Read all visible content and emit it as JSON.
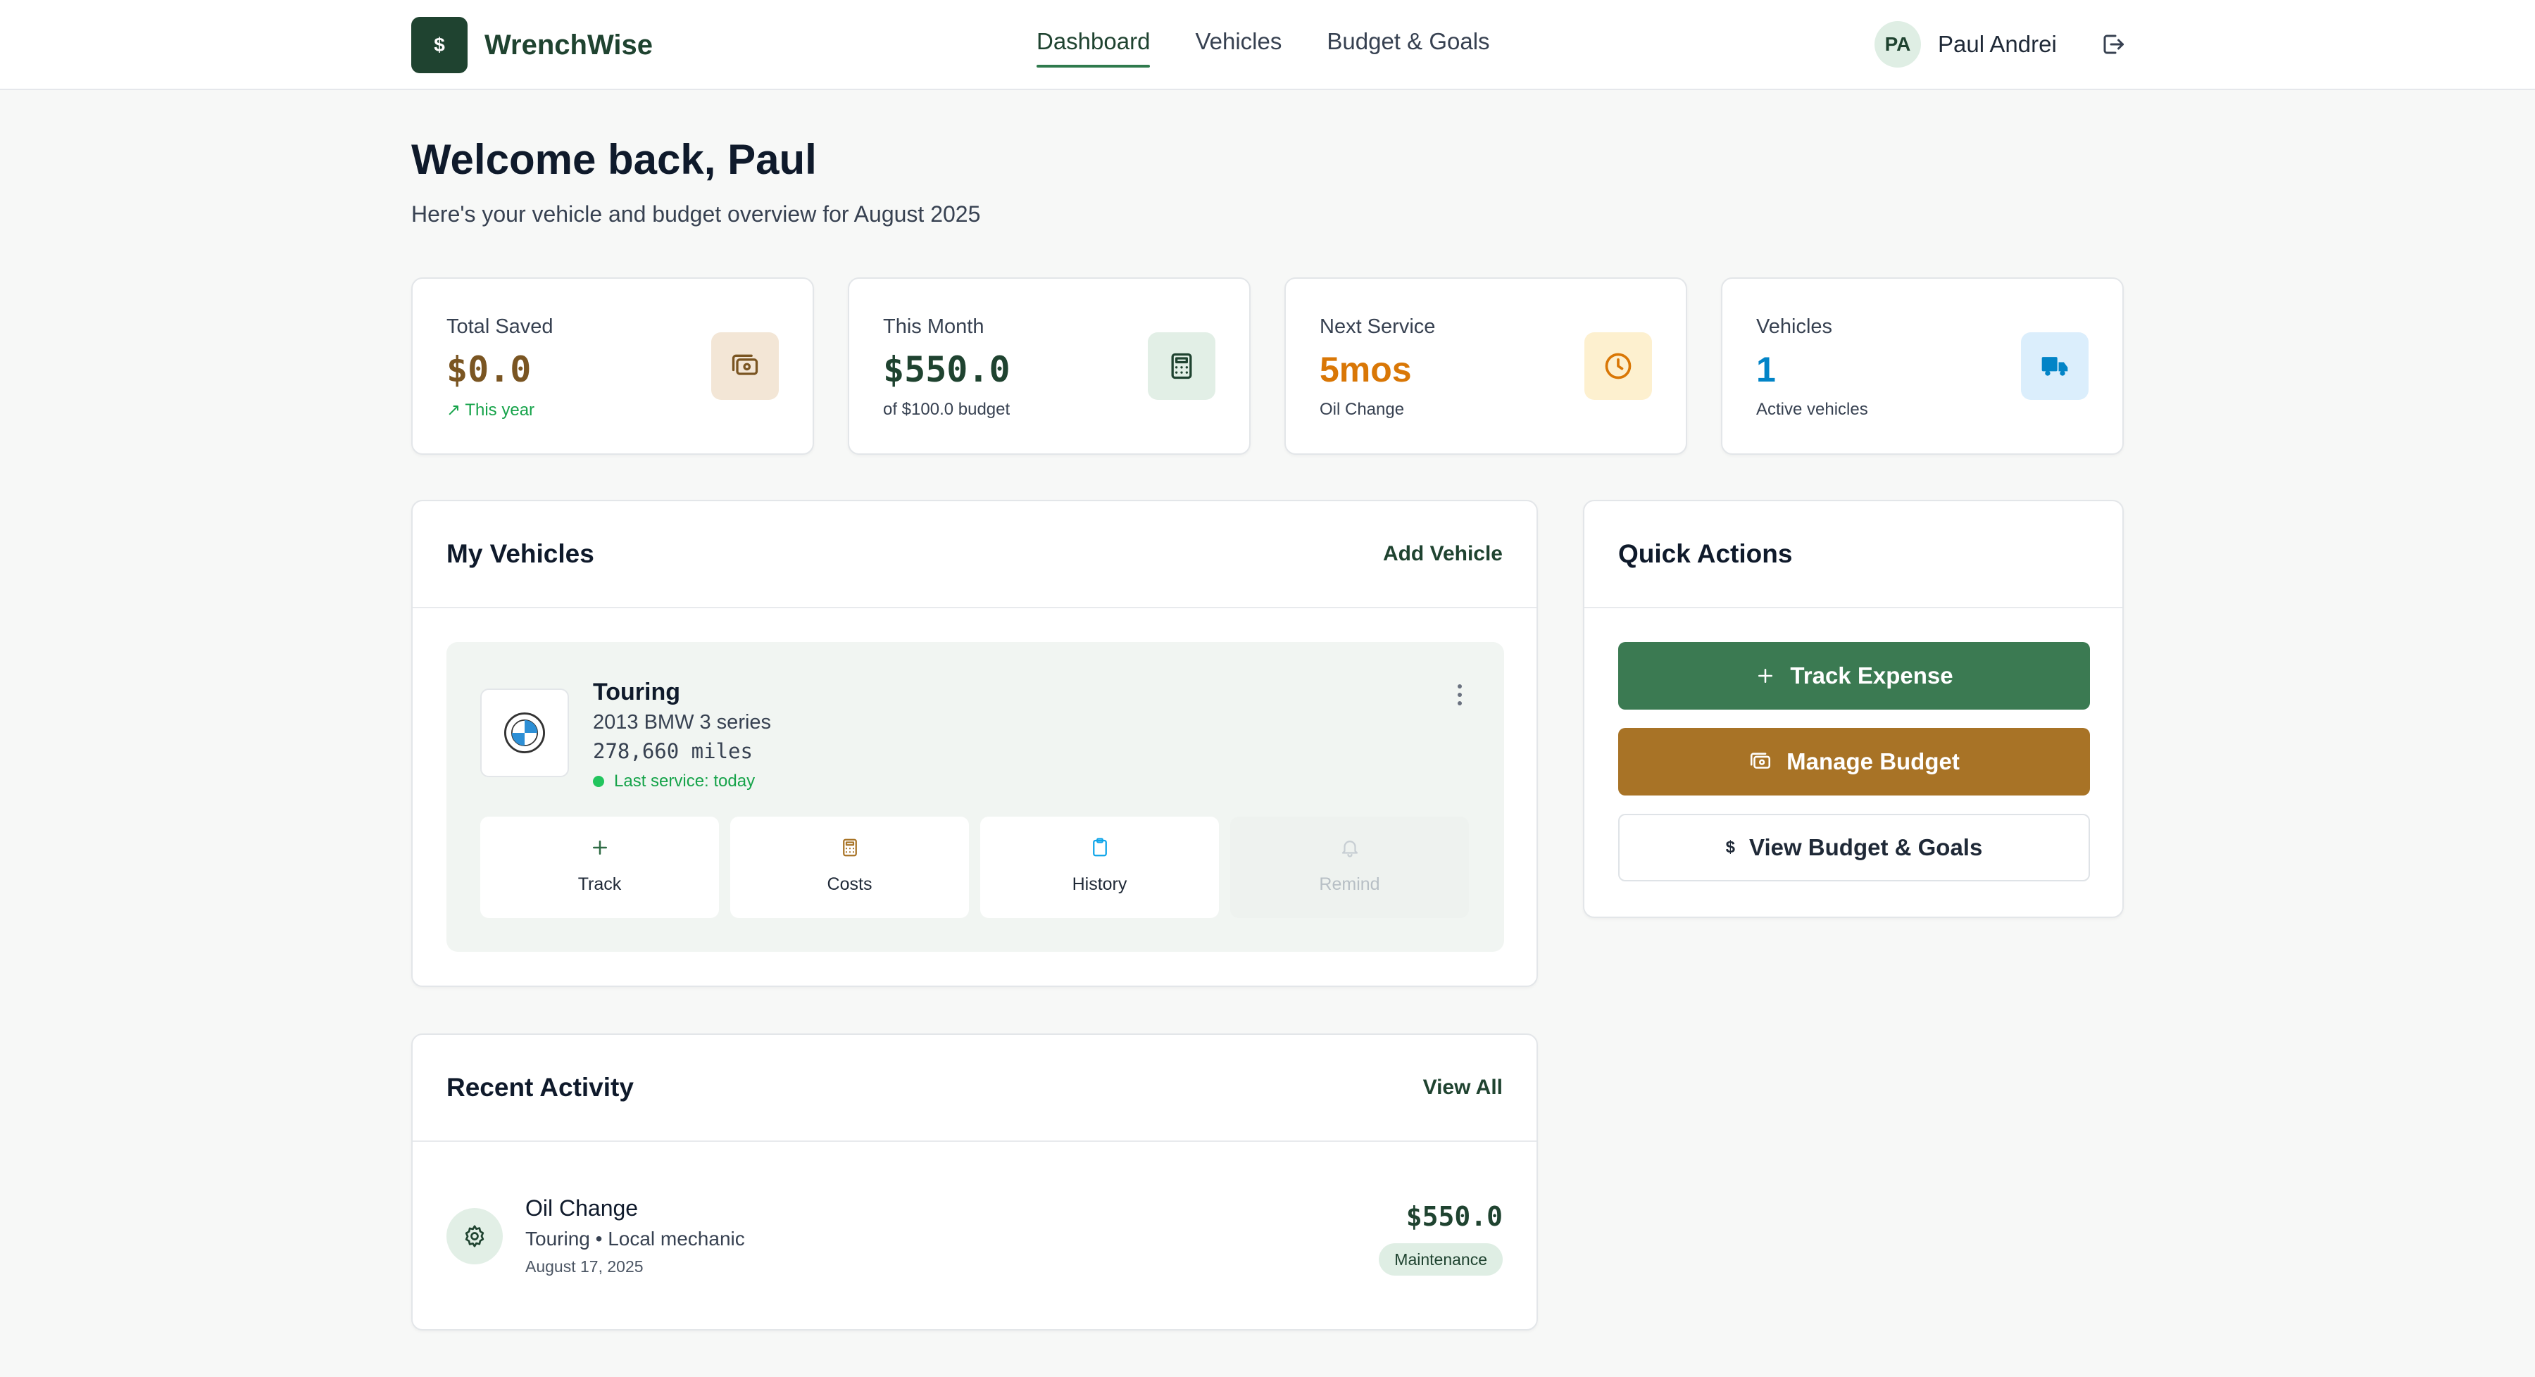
{
  "app": {
    "brand_logo_symbol": "$",
    "brand_name": "WrenchWise",
    "nav": [
      {
        "label": "Dashboard",
        "active": true
      },
      {
        "label": "Vehicles",
        "active": false
      },
      {
        "label": "Budget & Goals",
        "active": false
      }
    ],
    "user": {
      "initials": "PA",
      "name": "Paul Andrei"
    }
  },
  "welcome": {
    "title": "Welcome back, Paul",
    "subtitle": "Here's your vehicle and budget overview for August 2025"
  },
  "stats": [
    {
      "label": "Total Saved",
      "value": "$0.0",
      "sub": "↗ This year",
      "icon": "wallet-icon",
      "accent": "#7a5522",
      "icon_bg": "#f3e6d6"
    },
    {
      "label": "This Month",
      "value": "$550.0",
      "sub": "of $100.0 budget",
      "icon": "calculator-icon",
      "accent": "#1f4330",
      "icon_bg": "#e2efe6"
    },
    {
      "label": "Next Service",
      "value": "5mos",
      "sub": "Oil Change",
      "icon": "clock-icon",
      "accent": "#d97706",
      "icon_bg": "#fdf0cf"
    },
    {
      "label": "Vehicles",
      "value": "1",
      "sub": "Active vehicles",
      "icon": "truck-icon",
      "accent": "#0284c7",
      "icon_bg": "#dbeefc"
    }
  ],
  "vehicles_card": {
    "title": "My Vehicles",
    "add_label": "Add Vehicle",
    "vehicle": {
      "name": "Touring",
      "model": "2013 BMW 3 series",
      "miles": "278,660 miles",
      "last_service": "Last service: today"
    },
    "actions": [
      {
        "label": "Track",
        "icon": "plus-icon",
        "color": "#2f6b45",
        "disabled": false
      },
      {
        "label": "Costs",
        "icon": "calculator-icon",
        "color": "#a87326",
        "disabled": false
      },
      {
        "label": "History",
        "icon": "clipboard-icon",
        "color": "#0ea5e9",
        "disabled": false
      },
      {
        "label": "Remind",
        "icon": "bell-icon",
        "color": "#c7ced3",
        "disabled": true
      }
    ]
  },
  "activity_card": {
    "title": "Recent Activity",
    "view_all_label": "View All",
    "items": [
      {
        "title": "Oil Change",
        "meta": "Touring • Local mechanic",
        "date": "August 17, 2025",
        "amount": "$550.0",
        "tag": "Maintenance",
        "icon": "gear-icon"
      }
    ]
  },
  "quick_actions": {
    "title": "Quick Actions",
    "buttons": [
      {
        "label": "Track Expense",
        "icon": "plus-icon",
        "style": "green"
      },
      {
        "label": "Manage Budget",
        "icon": "wallet-icon",
        "style": "amber"
      },
      {
        "label": "View Budget & Goals",
        "icon": "dollar-icon",
        "style": "outline"
      }
    ]
  }
}
